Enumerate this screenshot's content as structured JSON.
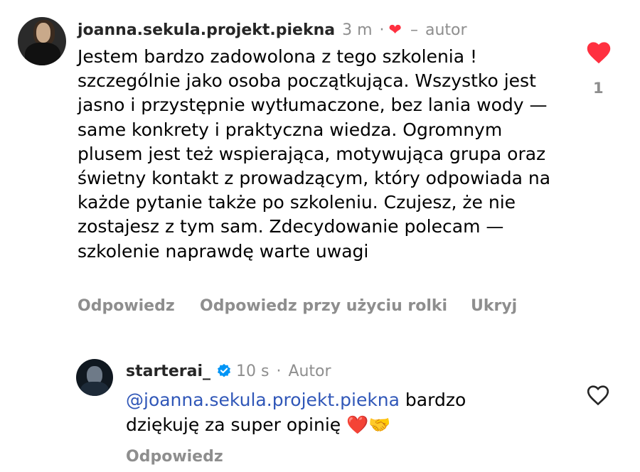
{
  "comment": {
    "username": "joanna.sekula.projekt.piekna",
    "time": "3 m",
    "dot": "·",
    "author_sep": "–",
    "author_label": "autor",
    "text": "Jestem bardzo zadowolona z tego szkolenia ! szczególnie jako osoba początkująca. Wszystko jest jasno i przystępnie wytłumaczone, bez lania wody — same konkrety i praktyczna wiedza. Ogromnym plusem jest też wspierająca, motywująca grupa oraz świetny kontakt z prowadzącym, który odpowiada na każde pytanie także po szkoleniu. Czujesz, że nie zostajesz z tym sam. Zdecydowanie polecam — szkolenie naprawdę warte uwagi",
    "actions": {
      "reply": "Odpowiedz",
      "reply_reel": "Odpowiedz przy użyciu rolki",
      "hide": "Ukryj"
    },
    "like_count": "1",
    "liked": true,
    "heart_color": "#ff3040"
  },
  "reply": {
    "username": "starterai_",
    "verified": true,
    "time": "10 s",
    "dot": "·",
    "author_label": "Autor",
    "mention": "@joanna.sekula.projekt.piekna",
    "text": " bardzo dziękuję za super opinię ",
    "emojis": "❤️🤝",
    "action_reply": "Odpowiedz",
    "liked": false
  },
  "colors": {
    "mention": "#3057b8",
    "meta_gray": "#8e8e8e",
    "verified_blue": "#0095f6"
  }
}
